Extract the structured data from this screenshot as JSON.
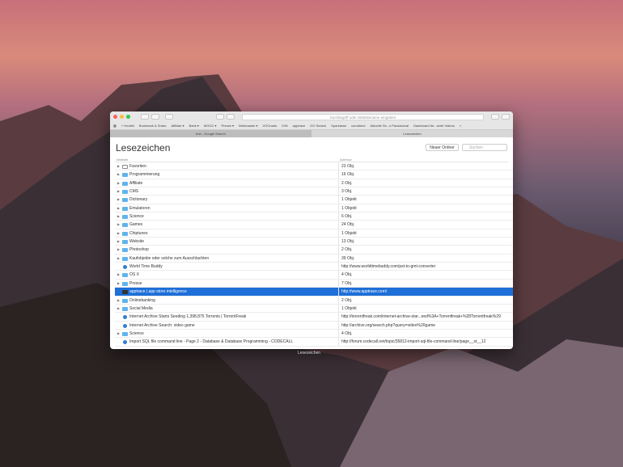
{
  "toolbar": {
    "url_placeholder": "Suchbegriff oder Websitename eingeben"
  },
  "bookmarks_bar": [
    "+ Hootlet",
    "Bookmark & Share",
    "Affiliate ▾",
    "Bank ▾",
    "MOOC ▾",
    "Presse ▾",
    "Webmaster ▾",
    "VGCharts",
    "IVW",
    "apptrace",
    "GO Search",
    "Sparkasse",
    "comdirect",
    "Aktuelle Sh...s Paradoxical",
    "Dashboard für...serte Videos",
    "»"
  ],
  "tabs": [
    {
      "label": "test - Google Search"
    },
    {
      "label": "Lesezeichen"
    }
  ],
  "page": {
    "title": "Lesezeichen",
    "new_folder": "Neuer Ordner",
    "search_placeholder": "Suchen",
    "col_website": "Website",
    "col_address": "Adresse"
  },
  "rows": [
    {
      "name": "Favoriten",
      "addr": "23 Obj.",
      "type": "book"
    },
    {
      "name": "Programmierung",
      "addr": "16 Obj.",
      "type": "folder"
    },
    {
      "name": "Affiliate",
      "addr": "2 Obj.",
      "type": "folder"
    },
    {
      "name": "CMS",
      "addr": "3 Obj.",
      "type": "folder"
    },
    {
      "name": "Dictionary",
      "addr": "1 Objekt",
      "type": "folder"
    },
    {
      "name": "Emulatoren",
      "addr": "1 Objekt",
      "type": "folder"
    },
    {
      "name": "Science",
      "addr": "6 Obj.",
      "type": "folder"
    },
    {
      "name": "Games",
      "addr": "24 Obj.",
      "type": "folder"
    },
    {
      "name": "Chiptunes",
      "addr": "1 Objekt",
      "type": "folder"
    },
    {
      "name": "Website",
      "addr": "13 Obj.",
      "type": "folder"
    },
    {
      "name": "Photoshop",
      "addr": "2 Obj.",
      "type": "folder"
    },
    {
      "name": "Kaufobjekte oder solche zum Ausschlachten",
      "addr": "39 Obj.",
      "type": "folder"
    },
    {
      "name": "World Time Buddy",
      "addr": "http://www.worldtimebuddy.com/pst-to-gmt-converter",
      "type": "globe"
    },
    {
      "name": "OS X",
      "addr": "4 Obj.",
      "type": "folder"
    },
    {
      "name": "Presse",
      "addr": "7 Obj.",
      "type": "folder"
    },
    {
      "name": "apptrace | app store intelligence",
      "addr": "http://www.apptrace.com/",
      "type": "app",
      "selected": true
    },
    {
      "name": "Onlinebanking",
      "addr": "2 Obj.",
      "type": "folder"
    },
    {
      "name": "Social Media",
      "addr": "1 Objekt",
      "type": "folder"
    },
    {
      "name": "Internet Archive Starts Seeding 1,398,875 Torrents | TorrentFreak",
      "addr": "http://torrentfreak.com/internet-archive-star...eed%3A+Torrentfreak+%28Torrentfreak%29",
      "type": "globe"
    },
    {
      "name": "Internet Archive Search: video game",
      "addr": "http://archive.org/search.php?query=video%20game",
      "type": "globe"
    },
    {
      "name": "Science",
      "addr": "4 Obj.",
      "type": "folder"
    },
    {
      "name": "Import SQL file command line - Page 2 - Database & Database Programming - CODECALL",
      "addr": "http://forum.codecall.net/topic/35812-import-sql-file-command-line/page__st__12",
      "type": "globe"
    }
  ],
  "caption": "Lesezeichen"
}
